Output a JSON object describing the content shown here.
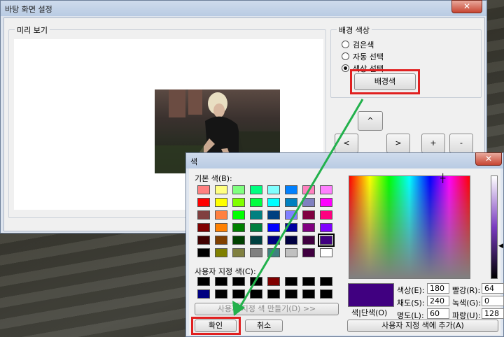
{
  "main_window": {
    "title": "바탕 화면 설정",
    "close": "✕",
    "preview_label": "미리 보기",
    "bg_color_label": "배경 색상",
    "radios": [
      {
        "label": "검은색",
        "selected": false
      },
      {
        "label": "자동 선택",
        "selected": false
      },
      {
        "label": "색상 선택",
        "selected": true
      }
    ],
    "bg_color_button": "배경색",
    "nav": {
      "up": "^",
      "left": "<",
      "right": ">",
      "plus": "+",
      "minus": "-"
    }
  },
  "color_dialog": {
    "title": "색",
    "close": "✕",
    "basic_colors_label": "기본 색(B):",
    "basic_colors": [
      [
        "#ff8080",
        "#ffff80",
        "#80ff80",
        "#00ff80",
        "#80ffff",
        "#0080ff",
        "#ff80c0",
        "#ff80ff"
      ],
      [
        "#ff0000",
        "#ffff00",
        "#80ff00",
        "#00ff40",
        "#00ffff",
        "#0080c0",
        "#8080c0",
        "#ff00ff"
      ],
      [
        "#804040",
        "#ff8040",
        "#00ff00",
        "#008080",
        "#004080",
        "#8080ff",
        "#800040",
        "#ff0080"
      ],
      [
        "#800000",
        "#ff8000",
        "#008000",
        "#008040",
        "#0000ff",
        "#0000a0",
        "#800080",
        "#8000ff"
      ],
      [
        "#400000",
        "#804000",
        "#004000",
        "#004040",
        "#000080",
        "#000040",
        "#400040",
        "#400080"
      ],
      [
        "#000000",
        "#808000",
        "#808040",
        "#808080",
        "#408080",
        "#c0c0c0",
        "#400040",
        "#ffffff"
      ]
    ],
    "custom_colors_label": "사용자 지정 색(C):",
    "custom_colors": [
      [
        "#000000",
        "#000000",
        "#000000",
        "#000000",
        "#800000",
        "#000000",
        "#000000",
        "#000000"
      ],
      [
        "#000080",
        "#000000",
        "#000000",
        "#000000",
        "#000000",
        "#000000",
        "#000000",
        "#000000"
      ]
    ],
    "define_custom_button": "사용자 지정 색 만들기(D) >>",
    "ok_button": "확인",
    "cancel_button": "취소",
    "solid_label": "색|단색(O)",
    "current_color": "#400080",
    "hue_label": "색상(E):",
    "hue_value": "180",
    "sat_label": "채도(S):",
    "sat_value": "240",
    "lum_label": "명도(L):",
    "lum_value": "60",
    "red_label": "빨강(R):",
    "red_value": "64",
    "green_label": "녹색(G):",
    "green_value": "0",
    "blue_label": "파랑(U):",
    "blue_value": "128",
    "add_custom_button": "사용자 지정 색에 추가(A)"
  },
  "colors": {
    "highlight": "#e02020",
    "arrow": "#22b14c"
  }
}
